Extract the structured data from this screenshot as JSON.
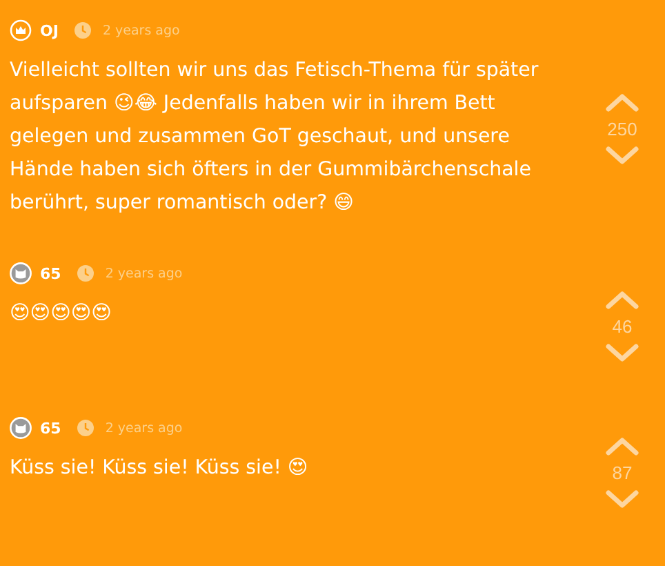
{
  "comments": [
    {
      "kind": "crown",
      "author": "OJ",
      "time": "2 years ago",
      "text": "Vielleicht sollten wir uns das Fetisch-Thema für später aufsparen 😉😂 Jedenfalls haben wir in ihrem Bett gelegen und zusammen GoT geschaut, und unsere Hände haben sich öfters in der Gummibärchenschale berührt, super romantisch oder? 😄",
      "votes": "250"
    },
    {
      "kind": "cat",
      "author": "65",
      "time": "2 years ago",
      "text": "😍😍😍😍😍",
      "votes": "46"
    },
    {
      "kind": "cat",
      "author": "65",
      "time": "2 years ago",
      "text": "Küss sie! Küss sie! Küss sie! 😍",
      "votes": "87"
    }
  ]
}
